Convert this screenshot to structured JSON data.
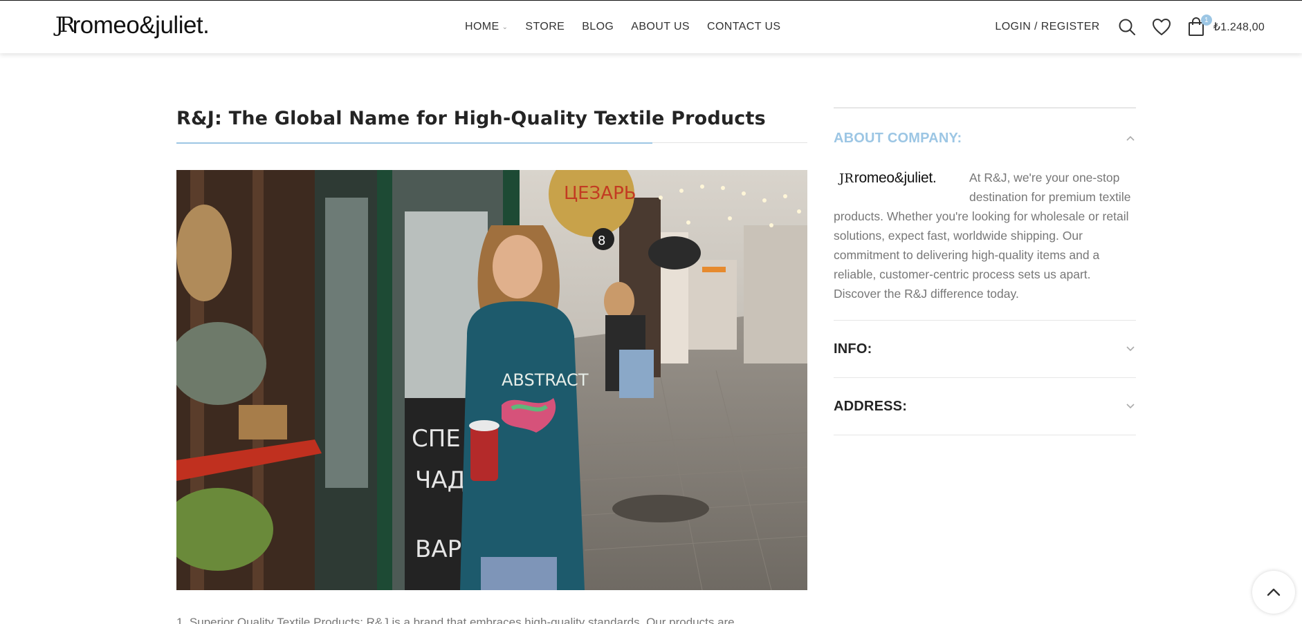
{
  "brand": {
    "mark": "JR",
    "name": "romeo&juliet."
  },
  "nav": {
    "items": [
      {
        "label": "HOME",
        "has_dropdown": true
      },
      {
        "label": "STORE"
      },
      {
        "label": "BLOG"
      },
      {
        "label": "ABOUT US"
      },
      {
        "label": "CONTACT US"
      }
    ]
  },
  "header": {
    "login_label": "LOGIN / REGISTER",
    "cart_count": "1",
    "cart_total": "₺1.248,00",
    "icons": [
      "search-icon",
      "heart-icon",
      "shopping-bag-icon"
    ]
  },
  "article": {
    "title": "R&J: The Global Name for High-Quality Textile Products",
    "hero_alt_icon": "photo-woman-in-hoodie",
    "body_first_line": "1. Superior Quality Textile Products: R&J is a brand that embraces high-quality standards. Our products are"
  },
  "sidebar": {
    "sections": [
      {
        "title": "ABOUT COMPANY:",
        "expanded": true,
        "logo_mark": "JR",
        "logo_name": "romeo&juliet.",
        "text": "At R&J, we're your one-stop destination for premium textile products. Whether you're looking for wholesale or retail solutions, expect fast, worldwide shipping. Our commitment to delivering high-quality items and a reliable, customer-centric process sets us apart. Discover the R&J difference today."
      },
      {
        "title": "INFO:",
        "expanded": false
      },
      {
        "title": "ADDRESS:",
        "expanded": false
      }
    ]
  },
  "colors": {
    "accent": "#9cc6e4",
    "text": "#242424",
    "muted": "#777777"
  }
}
